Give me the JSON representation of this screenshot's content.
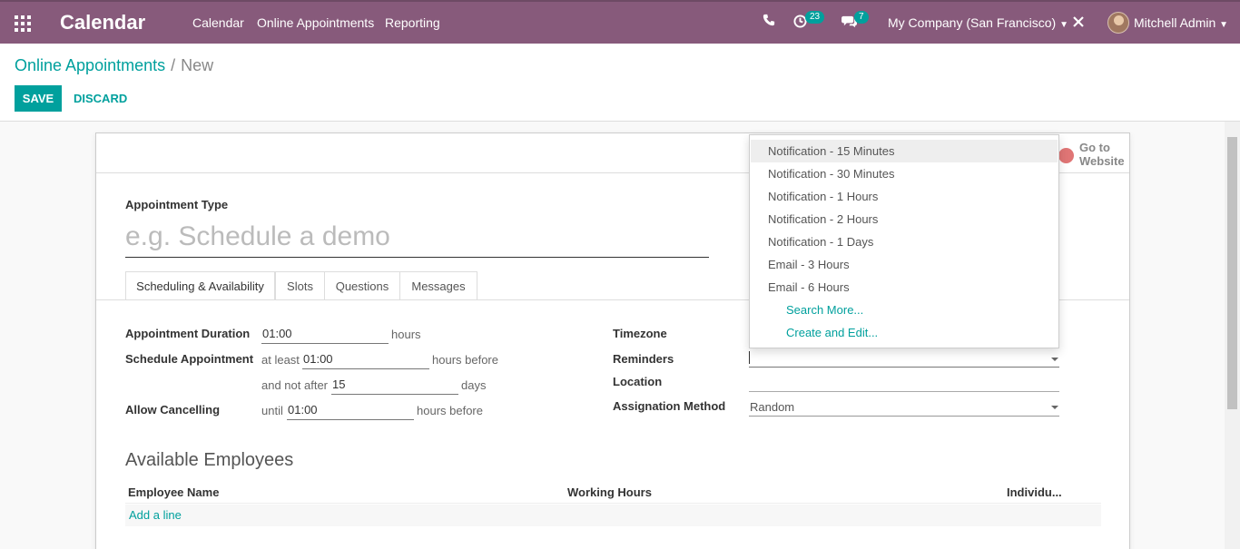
{
  "app": {
    "title": "Calendar"
  },
  "nav": {
    "menu": [
      "Calendar",
      "Online Appointments",
      "Reporting"
    ],
    "activity_badge": "23",
    "messages_badge": "7",
    "company": "My Company (San Francisco)",
    "user": "Mitchell Admin"
  },
  "breadcrumb": {
    "parent": "Online Appointments",
    "current": "New"
  },
  "buttons": {
    "save": "SAVE",
    "discard": "DISCARD"
  },
  "website_button": {
    "line1": "Go to",
    "line2": "Website"
  },
  "form": {
    "appointment_type_label": "Appointment Type",
    "appointment_type_placeholder": "e.g. Schedule a demo",
    "tabs": [
      "Scheduling & Availability",
      "Slots",
      "Questions",
      "Messages"
    ],
    "duration_label": "Appointment Duration",
    "duration_value": "01:00",
    "duration_unit": "hours",
    "schedule_label": "Schedule Appointment",
    "schedule_prefix": "at least",
    "schedule_value": "01:00",
    "schedule_suffix": "hours before",
    "not_after_prefix": "and not after",
    "not_after_value": "15",
    "not_after_suffix": "days",
    "cancel_label": "Allow Cancelling",
    "cancel_prefix": "until",
    "cancel_value": "01:00",
    "cancel_suffix": "hours before",
    "timezone_label": "Timezone",
    "reminders_label": "Reminders",
    "location_label": "Location",
    "assignation_label": "Assignation Method",
    "assignation_value": "Random"
  },
  "employees": {
    "title": "Available Employees",
    "columns": [
      "Employee Name",
      "Working Hours",
      "Individu..."
    ],
    "add_line": "Add a line"
  },
  "dropdown": {
    "items": [
      "Notification - 15 Minutes",
      "Notification - 30 Minutes",
      "Notification - 1 Hours",
      "Notification - 2 Hours",
      "Notification - 1 Days",
      "Email - 3 Hours",
      "Email - 6 Hours"
    ],
    "search_more": "Search More...",
    "create_edit": "Create and Edit..."
  },
  "colors": {
    "brand": "#875a7b",
    "accent": "#00a09d"
  }
}
